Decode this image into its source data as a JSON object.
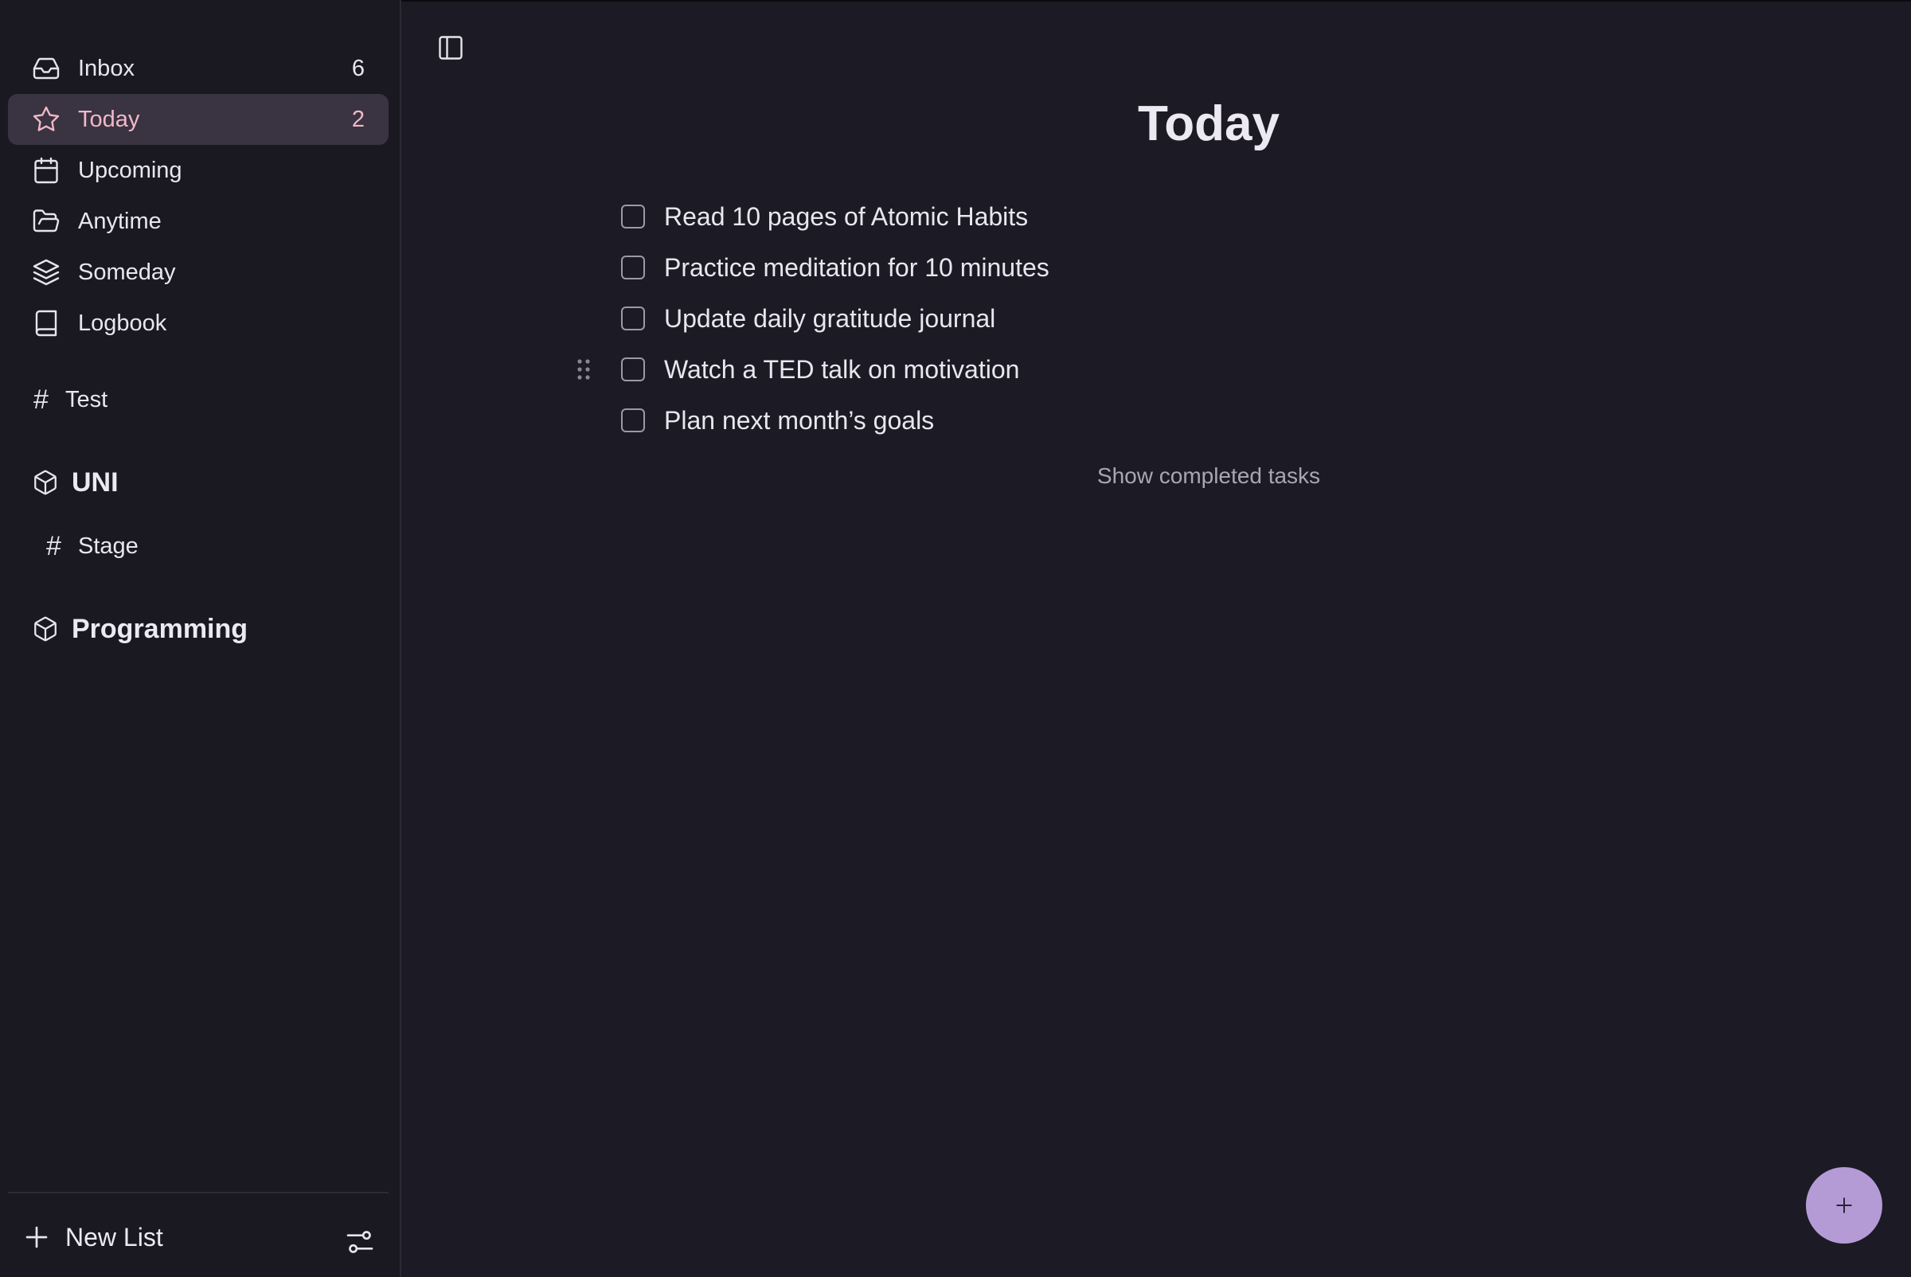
{
  "sidebar": {
    "nav": [
      {
        "label": "Inbox",
        "count": "6",
        "icon": "inbox-icon"
      },
      {
        "label": "Today",
        "count": "2",
        "icon": "star-icon",
        "active": true
      },
      {
        "label": "Upcoming",
        "count": "",
        "icon": "calendar-icon"
      },
      {
        "label": "Anytime",
        "count": "",
        "icon": "folder-open-icon"
      },
      {
        "label": "Someday",
        "count": "",
        "icon": "layers-icon"
      },
      {
        "label": "Logbook",
        "count": "",
        "icon": "book-icon"
      }
    ],
    "lists": [
      {
        "label": "Test"
      }
    ],
    "areas": [
      {
        "label": "UNI",
        "lists": [
          {
            "label": "Stage"
          }
        ]
      },
      {
        "label": "Programming",
        "lists": []
      }
    ],
    "new_list_label": "New List"
  },
  "main": {
    "title": "Today",
    "tasks": [
      {
        "text": "Read 10 pages of Atomic Habits",
        "done": false
      },
      {
        "text": "Practice meditation for 10 minutes",
        "done": false
      },
      {
        "text": "Update daily gratitude journal",
        "done": false
      },
      {
        "text": "Watch a TED talk on motivation",
        "done": false
      },
      {
        "text": "Plan next month’s goals",
        "done": false
      }
    ],
    "show_completed_label": "Show completed tasks",
    "fab_label": "+"
  },
  "colors": {
    "background": "#1c1b25",
    "sidebar": "#1a1921",
    "active_item_bg": "#3a3341",
    "active_accent": "#f0b8c8",
    "fab": "#b49bd6"
  }
}
